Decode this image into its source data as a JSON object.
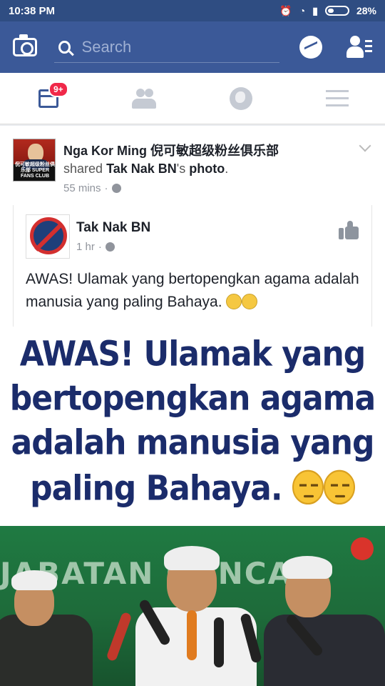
{
  "status_bar": {
    "time": "10:38 PM",
    "battery": "28%"
  },
  "top_bar": {
    "search_placeholder": "Search"
  },
  "tab_bar": {
    "notification_badge": "9+"
  },
  "post": {
    "poster_name": "Nga Kor Ming 倪可敏超级粉丝俱乐部",
    "shared_prefix": "shared",
    "shared_source": "Tak Nak BN",
    "shared_suffix": "'s",
    "shared_object": "photo",
    "shared_end": ".",
    "time": "55 mins",
    "separator": "·",
    "avatar_caption": "倪可敏超级粉丝俱乐部 SUPER FANS CLUB",
    "original": {
      "page_name": "Tak Nak BN",
      "time": "1 hr",
      "separator": "·",
      "text": "AWAS! Ulamak yang bertopengkan agama adalah manusia yang paling Bahaya."
    },
    "image_text": {
      "line1": "AWAS! Ulamak yang",
      "line2": "bertopengkan agama",
      "line3": "adalah manusia yang",
      "line4": "paling Bahaya."
    },
    "photo_banner": "JABATAN GUNCAS"
  }
}
